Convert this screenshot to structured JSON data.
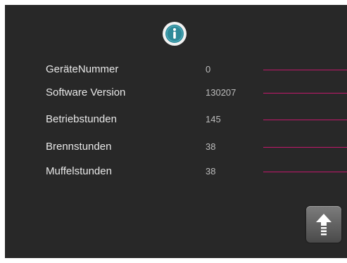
{
  "icons": {
    "info": "info-icon",
    "up": "arrow-up-icon"
  },
  "colors": {
    "background": "#282828",
    "accent_line": "#c2186b",
    "info_icon": "#2f8a99"
  },
  "info_rows": [
    {
      "label": "GeräteNummer",
      "value": "0"
    },
    {
      "label": "Software Version",
      "value": "130207"
    },
    {
      "label": "Betriebstunden",
      "value": "145"
    },
    {
      "label": "Brennstunden",
      "value": "38"
    },
    {
      "label": "Muffelstunden",
      "value": "38"
    }
  ]
}
